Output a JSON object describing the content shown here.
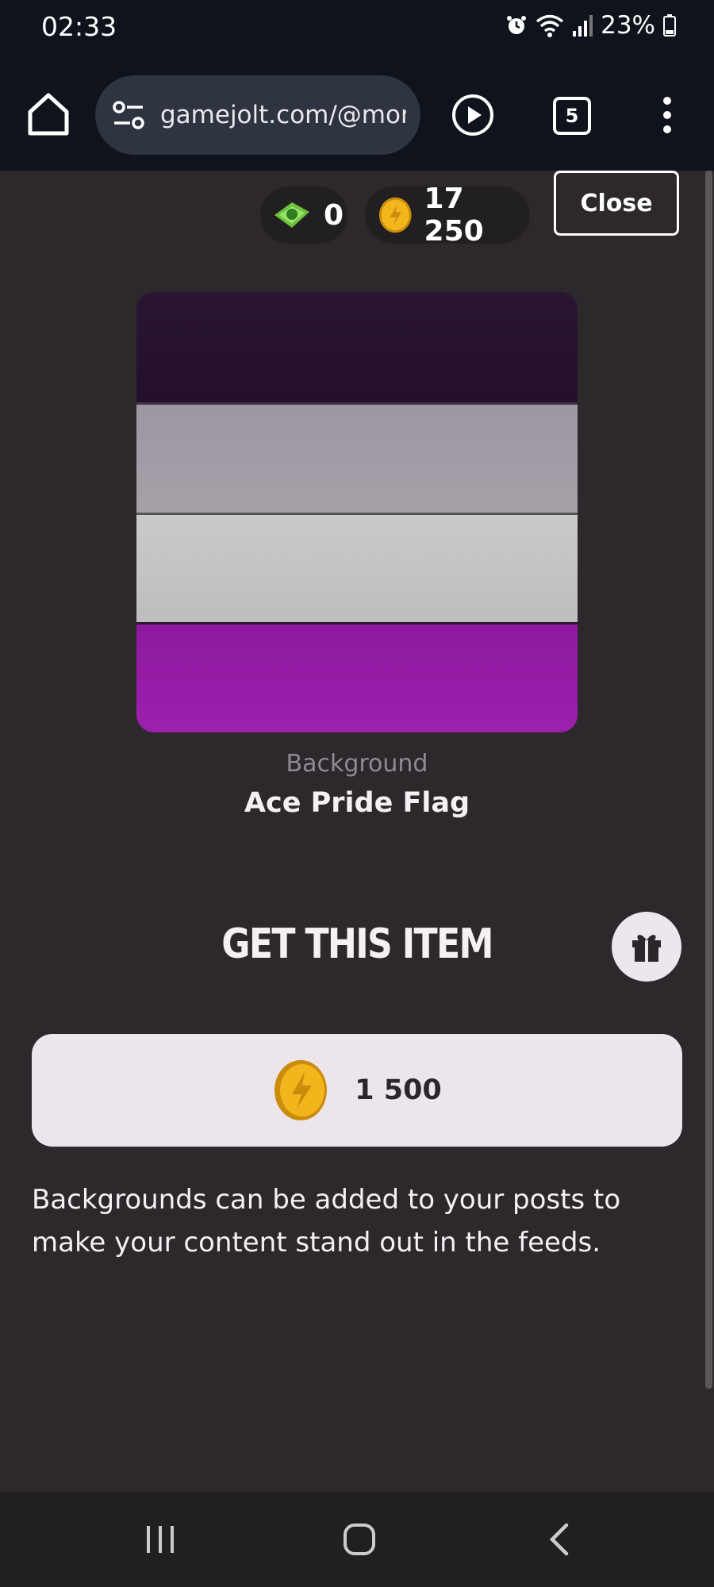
{
  "status_bar": {
    "time": "02:33",
    "battery": "23%",
    "icons": [
      "alarm-icon",
      "wifi-icon",
      "signal-icon",
      "battery-icon"
    ]
  },
  "browser": {
    "url": "gamejolt.com/@mora",
    "tab_count": "5",
    "icons": [
      "home-icon",
      "site-settings-icon",
      "play-icon",
      "menu-icon"
    ]
  },
  "wallet": {
    "cash_amount": "0",
    "coin_amount": "17 250"
  },
  "close_label": "Close",
  "item": {
    "type": "Background",
    "name": "Ace Pride Flag",
    "flag_colors": [
      "#241029",
      "#a39ca6",
      "#c4c4c4",
      "#951fa8"
    ]
  },
  "purchase": {
    "title": "GET THIS ITEM",
    "price": "1 500",
    "description": "Backgrounds can be added to your posts to make your content stand out in the feeds."
  },
  "colors": {
    "page_bg": "#2c282c",
    "chrome_bg": "#0e131c",
    "button_bg": "#ece6ec",
    "coin": "#f2b51c"
  }
}
